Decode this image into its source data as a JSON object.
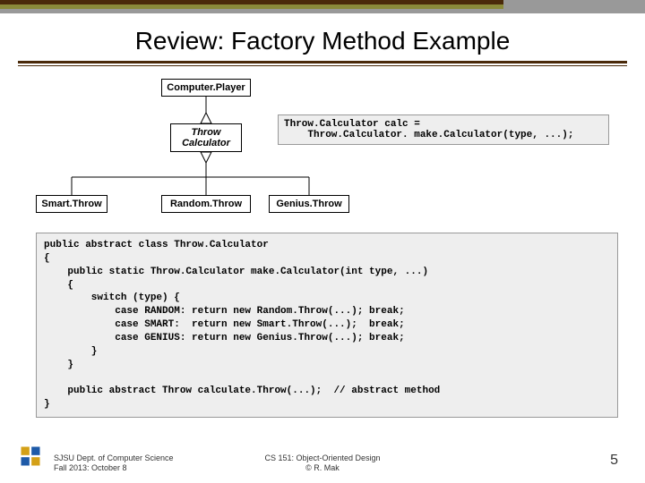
{
  "title": "Review: Factory Method Example",
  "uml": {
    "top": "Computer.Player",
    "mid": "Throw\nCalculator",
    "left": "Smart.Throw",
    "center": "Random.Throw",
    "right": "Genius.Throw"
  },
  "snippet": "Throw.Calculator calc =\n    Throw.Calculator. make.Calculator(type, ...);",
  "code": "public abstract class Throw.Calculator\n{\n    public static Throw.Calculator make.Calculator(int type, ...)\n    {\n        switch (type) {\n            case RANDOM: return new Random.Throw(...); break;\n            case SMART:  return new Smart.Throw(...);  break;\n            case GENIUS: return new Genius.Throw(...); break;\n        }\n    }\n\n    public abstract Throw calculate.Throw(...);  // abstract method\n}",
  "footer": {
    "dept": "SJSU Dept. of Computer Science\nFall 2013: October 8",
    "course": "CS 151: Object-Oriented Design\n© R. Mak",
    "page": "5"
  }
}
